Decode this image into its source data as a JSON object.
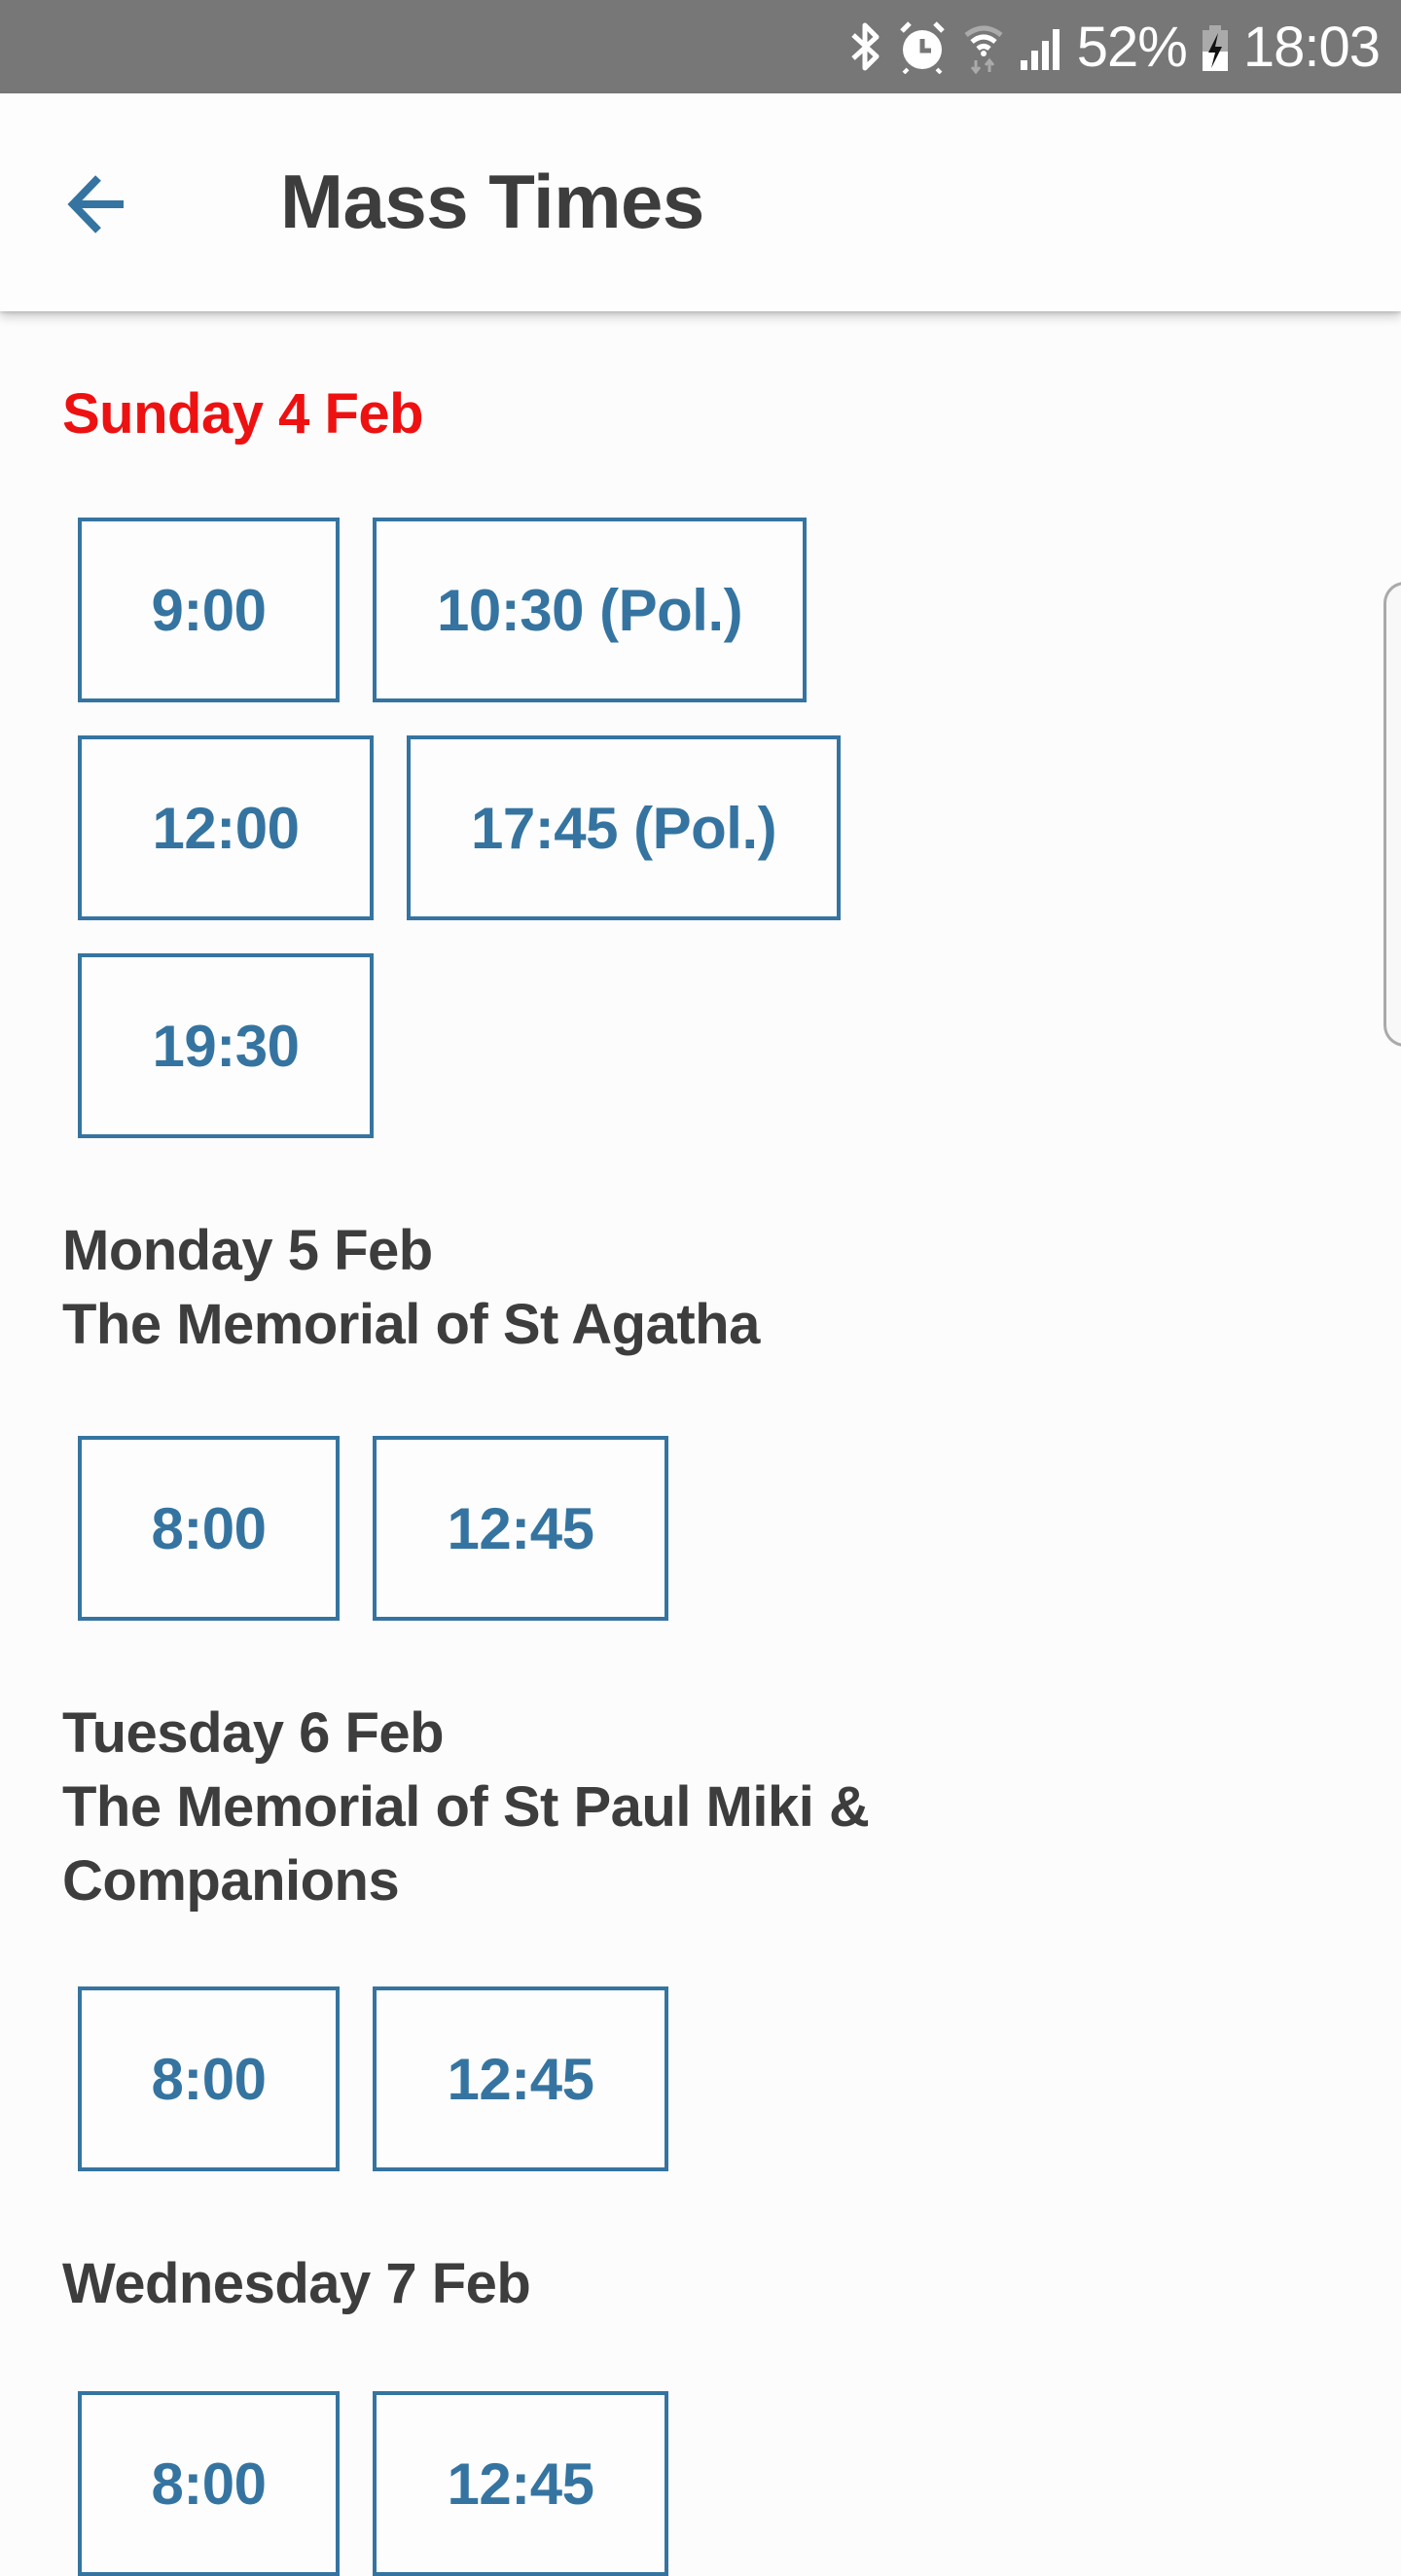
{
  "status_bar": {
    "icons": [
      "bluetooth-icon",
      "alarm-icon",
      "wifi-icon",
      "cell-signal-icon"
    ],
    "battery_percent": "52%",
    "battery_state": "charging",
    "time": "18:03"
  },
  "app_bar": {
    "back_icon": "arrow-left-icon",
    "title": "Mass Times"
  },
  "colors": {
    "accent": "#3574a0",
    "today": "#ee1111",
    "text": "#3d3d3d",
    "status_bar": "#777777"
  },
  "days": [
    {
      "heading": "Sunday 4 Feb",
      "subtitle": "",
      "is_today": true,
      "times": [
        "9:00",
        "10:30 (Pol.)",
        "12:00",
        "17:45 (Pol.)",
        "19:30"
      ]
    },
    {
      "heading": "Monday 5 Feb",
      "subtitle": "The Memorial of St Agatha",
      "is_today": false,
      "times": [
        "8:00",
        "12:45"
      ]
    },
    {
      "heading": "Tuesday 6 Feb",
      "subtitle": "The Memorial of St Paul Miki & Companions",
      "is_today": false,
      "times": [
        "8:00",
        "12:45"
      ]
    },
    {
      "heading": "Wednesday 7 Feb",
      "subtitle": "",
      "is_today": false,
      "times": [
        "8:00",
        "12:45"
      ]
    }
  ]
}
